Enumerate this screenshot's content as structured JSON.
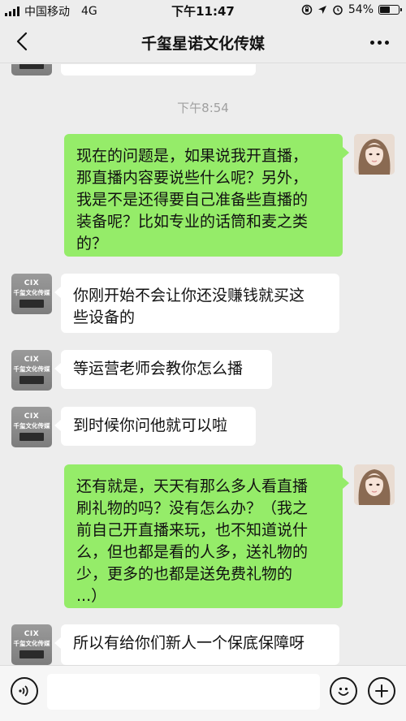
{
  "status_bar": {
    "carrier": "中国移动",
    "network": "4G",
    "time": "下午11:47",
    "battery_text": "54%",
    "battery_level": 0.54
  },
  "header": {
    "back_icon": "chevron-left-icon",
    "title": "千玺星诺文化传媒",
    "more_icon": "more-dots-icon"
  },
  "chat": {
    "timestamp": "下午8:54",
    "company_avatar": {
      "logo_text": "CIX",
      "name_text": "千玺文化传媒"
    },
    "messages": [
      {
        "side": "right",
        "text": "现在的问题是，如果说我开直播，\n那直播内容要说些什么呢？另外，\n我是不是还得要自己准备些直播的\n装备呢？比如专业的话筒和麦之类\n的？"
      },
      {
        "side": "left",
        "text": "你刚开始不会让你还没赚钱就买这\n些设备的"
      },
      {
        "side": "left",
        "text": "等运营老师会教你怎么播"
      },
      {
        "side": "left",
        "text": "到时候你问他就可以啦"
      },
      {
        "side": "right",
        "text": "还有就是，天天有那么多人看直播\n刷礼物的吗？没有怎么办？（我之\n前自己开直播来玩，也不知道说什\n么，但也都是看的人多，送礼物的\n少，更多的也都是送免费礼物的\n...）"
      },
      {
        "side": "left",
        "text": "所以有给你们新人一个保底保障呀"
      }
    ]
  },
  "input_bar": {
    "voice_icon": "voice-icon",
    "emoji_icon": "emoji-icon",
    "add_icon": "plus-icon",
    "placeholder": ""
  }
}
